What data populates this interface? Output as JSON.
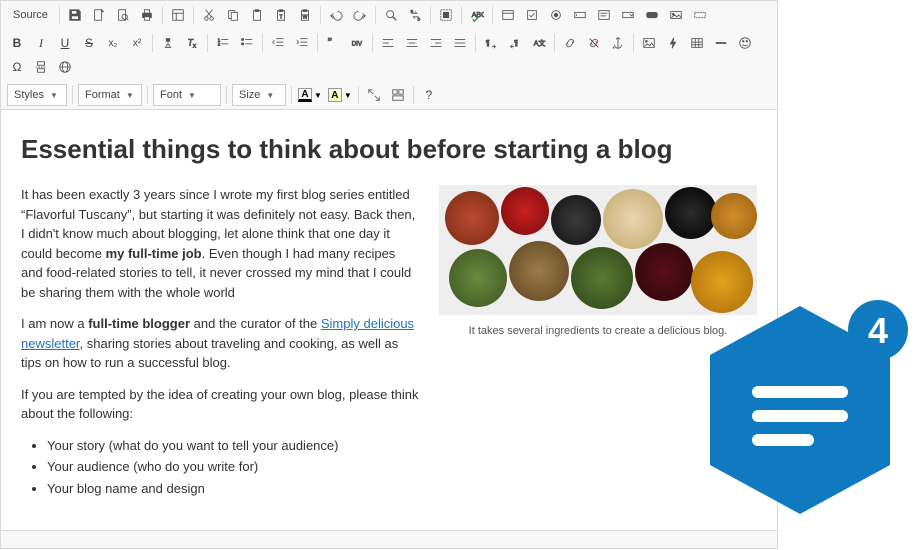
{
  "toolbar": {
    "source_label": "Source",
    "row1": [
      {
        "sep": true
      },
      {
        "name": "save-icon",
        "title": "Save"
      },
      {
        "name": "new-page-icon",
        "title": "New Page"
      },
      {
        "name": "preview-icon",
        "title": "Preview"
      },
      {
        "name": "print-icon",
        "title": "Print"
      },
      {
        "sep": true
      },
      {
        "name": "templates-icon",
        "title": "Templates"
      },
      {
        "sep": true
      },
      {
        "name": "cut-icon",
        "title": "Cut"
      },
      {
        "name": "copy-icon",
        "title": "Copy"
      },
      {
        "name": "paste-icon",
        "title": "Paste"
      },
      {
        "name": "paste-text-icon",
        "title": "Paste as plain text"
      },
      {
        "name": "paste-word-icon",
        "title": "Paste from Word"
      },
      {
        "sep": true
      },
      {
        "name": "undo-icon",
        "title": "Undo"
      },
      {
        "name": "redo-icon",
        "title": "Redo"
      },
      {
        "sep": true
      },
      {
        "name": "find-icon",
        "title": "Find"
      },
      {
        "name": "replace-icon",
        "title": "Replace"
      },
      {
        "sep": true
      },
      {
        "name": "select-all-icon",
        "title": "Select All"
      },
      {
        "sep": true
      },
      {
        "name": "spellcheck-icon",
        "title": "Spell Check"
      },
      {
        "sep": true
      },
      {
        "name": "form-icon",
        "title": "Form"
      },
      {
        "name": "checkbox-icon",
        "title": "Checkbox"
      },
      {
        "name": "radio-icon",
        "title": "Radio"
      },
      {
        "name": "text-field-icon",
        "title": "Text Field"
      },
      {
        "name": "textarea-icon",
        "title": "Textarea"
      },
      {
        "name": "select-icon",
        "title": "Select"
      },
      {
        "name": "button-icon",
        "title": "Button"
      },
      {
        "name": "image-button-icon",
        "title": "Image Button"
      },
      {
        "name": "hidden-field-icon",
        "title": "Hidden Field"
      }
    ],
    "row2": [
      {
        "name": "bold-icon",
        "title": "Bold",
        "text": "B",
        "style": "font-weight:bold;"
      },
      {
        "name": "italic-icon",
        "title": "Italic",
        "text": "I",
        "style": "font-style:italic;font-family:serif;"
      },
      {
        "name": "underline-icon",
        "title": "Underline",
        "text": "U",
        "style": "text-decoration:underline;"
      },
      {
        "name": "strike-icon",
        "title": "Strike",
        "text": "S",
        "style": "text-decoration:line-through;"
      },
      {
        "name": "subscript-icon",
        "title": "Subscript",
        "text": "x₂",
        "style": "font-size:10px;"
      },
      {
        "name": "superscript-icon",
        "title": "Superscript",
        "text": "x²",
        "style": "font-size:10px;"
      },
      {
        "sep": true
      },
      {
        "name": "copy-format-icon",
        "title": "Copy Formatting"
      },
      {
        "name": "remove-format-icon",
        "title": "Remove Format"
      },
      {
        "sep": true
      },
      {
        "name": "number-list-icon",
        "title": "Numbered List"
      },
      {
        "name": "bullet-list-icon",
        "title": "Bulleted List"
      },
      {
        "sep": true
      },
      {
        "name": "outdent-icon",
        "title": "Outdent"
      },
      {
        "name": "indent-icon",
        "title": "Indent"
      },
      {
        "sep": true
      },
      {
        "name": "blockquote-icon",
        "title": "Blockquote"
      },
      {
        "name": "div-icon",
        "title": "Div"
      },
      {
        "sep": true
      },
      {
        "name": "align-left-icon",
        "title": "Align Left"
      },
      {
        "name": "align-center-icon",
        "title": "Align Center"
      },
      {
        "name": "align-right-icon",
        "title": "Align Right"
      },
      {
        "name": "justify-icon",
        "title": "Justify"
      },
      {
        "sep": true
      },
      {
        "name": "ltr-icon",
        "title": "LTR"
      },
      {
        "name": "rtl-icon",
        "title": "RTL"
      },
      {
        "name": "language-icon",
        "title": "Language"
      },
      {
        "sep": true
      },
      {
        "name": "link-icon",
        "title": "Link"
      },
      {
        "name": "unlink-icon",
        "title": "Unlink"
      },
      {
        "name": "anchor-icon",
        "title": "Anchor"
      },
      {
        "sep": true
      },
      {
        "name": "image-icon",
        "title": "Image"
      },
      {
        "name": "flash-icon",
        "title": "Flash"
      },
      {
        "name": "table-icon",
        "title": "Table"
      },
      {
        "name": "hr-icon",
        "title": "Horizontal Line"
      },
      {
        "name": "smiley-icon",
        "title": "Smiley"
      },
      {
        "name": "special-char-icon",
        "title": "Special Char",
        "text": "Ω"
      },
      {
        "name": "pagebreak-icon",
        "title": "Page Break"
      },
      {
        "name": "iframe-icon",
        "title": "IFrame"
      }
    ],
    "row3": {
      "styles_label": "Styles",
      "format_label": "Format",
      "font_label": "Font",
      "size_label": "Size",
      "trailing": [
        {
          "name": "maximize-icon",
          "title": "Maximize"
        },
        {
          "name": "show-blocks-icon",
          "title": "Show Blocks"
        },
        {
          "sep": true
        },
        {
          "name": "about-icon",
          "title": "About",
          "text": "?"
        }
      ]
    }
  },
  "doc": {
    "title": "Essential things to think about before starting a blog",
    "p1_pre": "It has been exactly 3 years since I wrote my first blog series entitled “Flavorful Tuscany”, but starting it was definitely not easy. Back then, I didn't know much about blogging, let alone think that one day it could become ",
    "p1_bold": "my full-time job",
    "p1_post": ". Even though I had many recipes and food-related stories to tell, it never crossed my mind that I could be sharing them with the whole world",
    "p2_pre": "I am now a ",
    "p2_bold": "full-time blogger",
    "p2_mid": " and the curator of the ",
    "p2_link": "Simply delicious newsletter",
    "p2_post": ", sharing stories about traveling and cooking, as well as tips on how to run a successful blog.",
    "p3": "If you are tempted by the idea of creating your own blog, please think about the following:",
    "li1": "Your story (what do you want to tell your audience)",
    "li2": "Your audience (who do you write for)",
    "li3": "Your blog name and design",
    "caption": "It takes several ingredients to create a delicious blog."
  },
  "badge": {
    "count": "4",
    "color": "#0f7ac0"
  }
}
